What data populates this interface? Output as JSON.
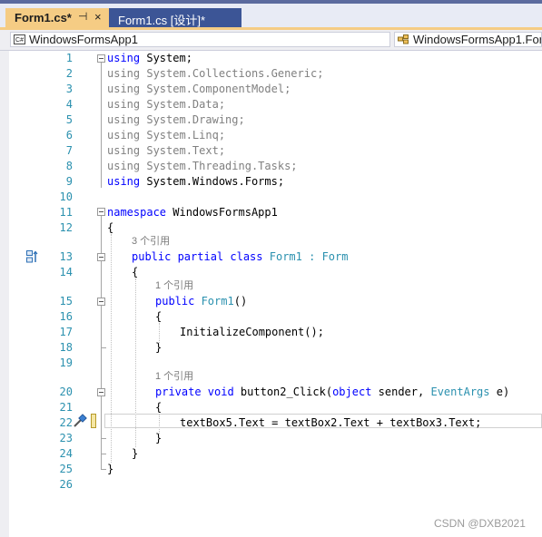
{
  "tabs": [
    {
      "label": "Form1.cs*",
      "pin": "⊣",
      "close": "×"
    },
    {
      "label": "Form1.cs [设计]*"
    }
  ],
  "nav": {
    "project_icon_text": "C#",
    "project": "WindowsFormsApp1",
    "class_path": "WindowsFormsApp1.For"
  },
  "editor": {
    "line_numbers": [
      "1",
      "2",
      "3",
      "4",
      "5",
      "6",
      "7",
      "8",
      "9",
      "10",
      "11",
      "12",
      "13",
      "14",
      "15",
      "16",
      "17",
      "18",
      "19",
      "20",
      "21",
      "22",
      "23",
      "24",
      "25",
      "26"
    ],
    "usings": [
      {
        "kw": "using",
        "ns": " System;"
      },
      {
        "kw": "using",
        "ns": " System.Collections.Generic;"
      },
      {
        "kw": "using",
        "ns": " System.ComponentModel;"
      },
      {
        "kw": "using",
        "ns": " System.Data;"
      },
      {
        "kw": "using",
        "ns": " System.Drawing;"
      },
      {
        "kw": "using",
        "ns": " System.Linq;"
      },
      {
        "kw": "using",
        "ns": " System.Text;"
      },
      {
        "kw": "using",
        "ns": " System.Threading.Tasks;"
      },
      {
        "kw": "using",
        "ns": " System.Windows.Forms;"
      }
    ],
    "ns_kw": "namespace",
    "ns_name": " WindowsFormsApp1",
    "brace_open": "{",
    "brace_close": "}",
    "ref_class": "3 个引用",
    "class_public": "public",
    "class_partial": " partial",
    "class_kw": " class",
    "class_name": " Form1",
    "class_colon": " : ",
    "class_base": "Form",
    "ref_ctor": "1 个引用",
    "ctor_public": "public",
    "ctor_name": " Form1",
    "ctor_parens": "()",
    "init_call": "InitializeComponent();",
    "ref_method": "1 个引用",
    "m_private": "private",
    "m_void": " void",
    "m_name": " button2_Click(",
    "m_object": "object",
    "m_sender": " sender, ",
    "m_eventargs": "EventArgs",
    "m_e": " e)",
    "assign_stmt": "textBox5.Text = textBox2.Text + textBox3.Text;"
  },
  "watermark": "CSDN @DXB2021"
}
